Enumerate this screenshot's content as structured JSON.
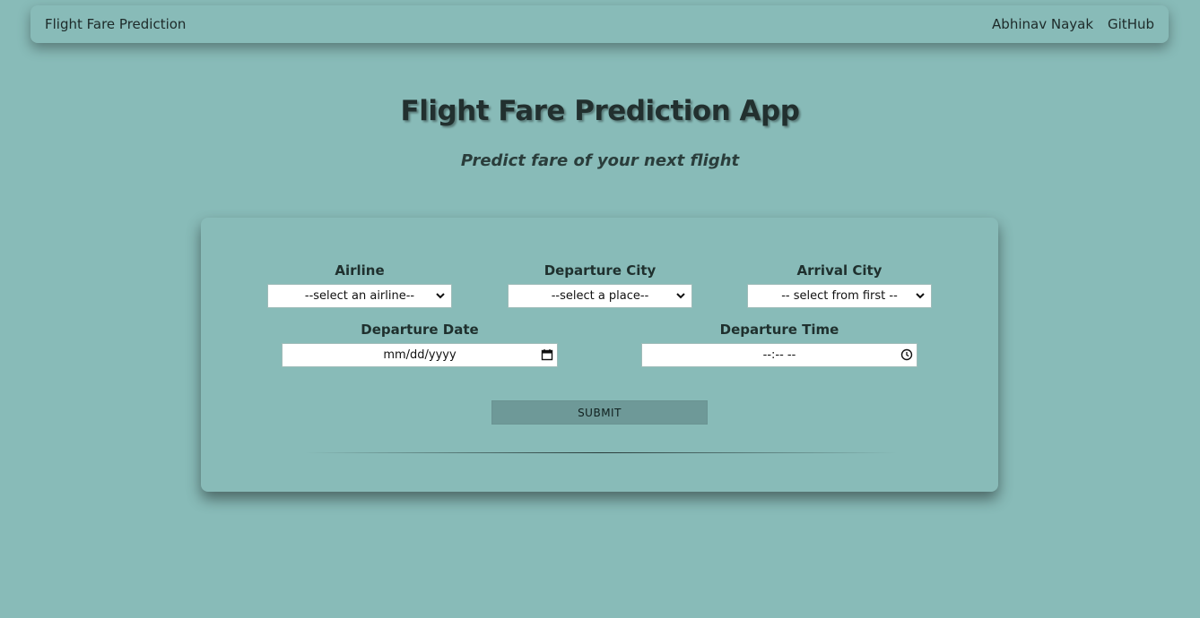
{
  "navbar": {
    "brand": "Flight Fare Prediction",
    "links": [
      "Abhinav Nayak",
      "GitHub"
    ]
  },
  "hero": {
    "title": "Flight Fare Prediction App",
    "subtitle": "Predict fare of your next flight"
  },
  "form": {
    "airline": {
      "label": "Airline",
      "selected": "--select an airline--"
    },
    "departure_city": {
      "label": "Departure City",
      "selected": "--select a place--"
    },
    "arrival_city": {
      "label": "Arrival City",
      "selected": "-- select from first --"
    },
    "departure_date": {
      "label": "Departure Date",
      "value": "mm/dd/yyyy"
    },
    "departure_time": {
      "label": "Departure Time",
      "value": "--:-- --"
    },
    "submit_label": "SUBMIT"
  },
  "colors": {
    "background": "#88bbb8",
    "button": "#6e9998",
    "text": "#1f302e"
  },
  "icons": {
    "select_arrow": "chevron-down-icon",
    "date_picker": "calendar-icon",
    "time_picker": "clock-icon"
  }
}
